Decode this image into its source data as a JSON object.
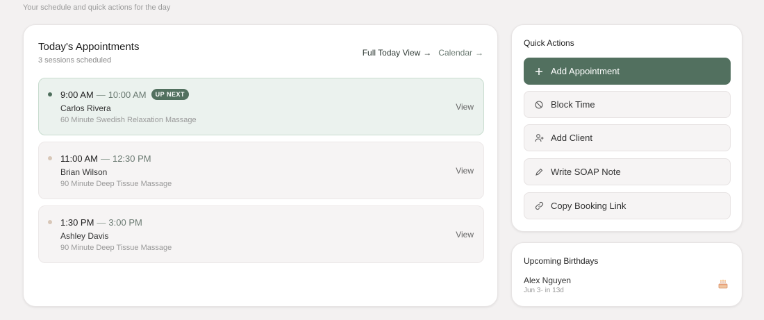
{
  "page": {
    "subtitle": "Your schedule and quick actions for the day"
  },
  "appointments": {
    "title": "Today's Appointments",
    "count": "3 sessions scheduled",
    "full_today_label": "Full Today View",
    "calendar_label": "Calendar",
    "items": [
      {
        "start": "9:00 AM",
        "sep": "—",
        "end": "10:00 AM",
        "badge": "UP NEXT",
        "client": "Carlos Rivera",
        "service": "60 Minute Swedish Relaxation Massage",
        "view": "View"
      },
      {
        "start": "11:00 AM",
        "sep": "—",
        "end": "12:30 PM",
        "client": "Brian Wilson",
        "service": "90 Minute Deep Tissue Massage",
        "view": "View"
      },
      {
        "start": "1:30 PM",
        "sep": "—",
        "end": "3:00 PM",
        "client": "Ashley Davis",
        "service": "90 Minute Deep Tissue Massage",
        "view": "View"
      }
    ]
  },
  "quick_actions": {
    "title": "Quick Actions",
    "items": [
      {
        "label": "Add Appointment",
        "icon": "plus-icon"
      },
      {
        "label": "Block Time",
        "icon": "block-icon"
      },
      {
        "label": "Add Client",
        "icon": "user-plus-icon"
      },
      {
        "label": "Write SOAP Note",
        "icon": "pencil-icon"
      },
      {
        "label": "Copy Booking Link",
        "icon": "link-icon"
      }
    ]
  },
  "birthdays": {
    "title": "Upcoming Birthdays",
    "name": "Alex Nguyen",
    "date": "Jun 3· in 13d",
    "icon": "cake-icon"
  },
  "colors": {
    "accent": "#52705f",
    "active_bg": "#ebf2ee",
    "page_bg": "#f3f1f1"
  }
}
